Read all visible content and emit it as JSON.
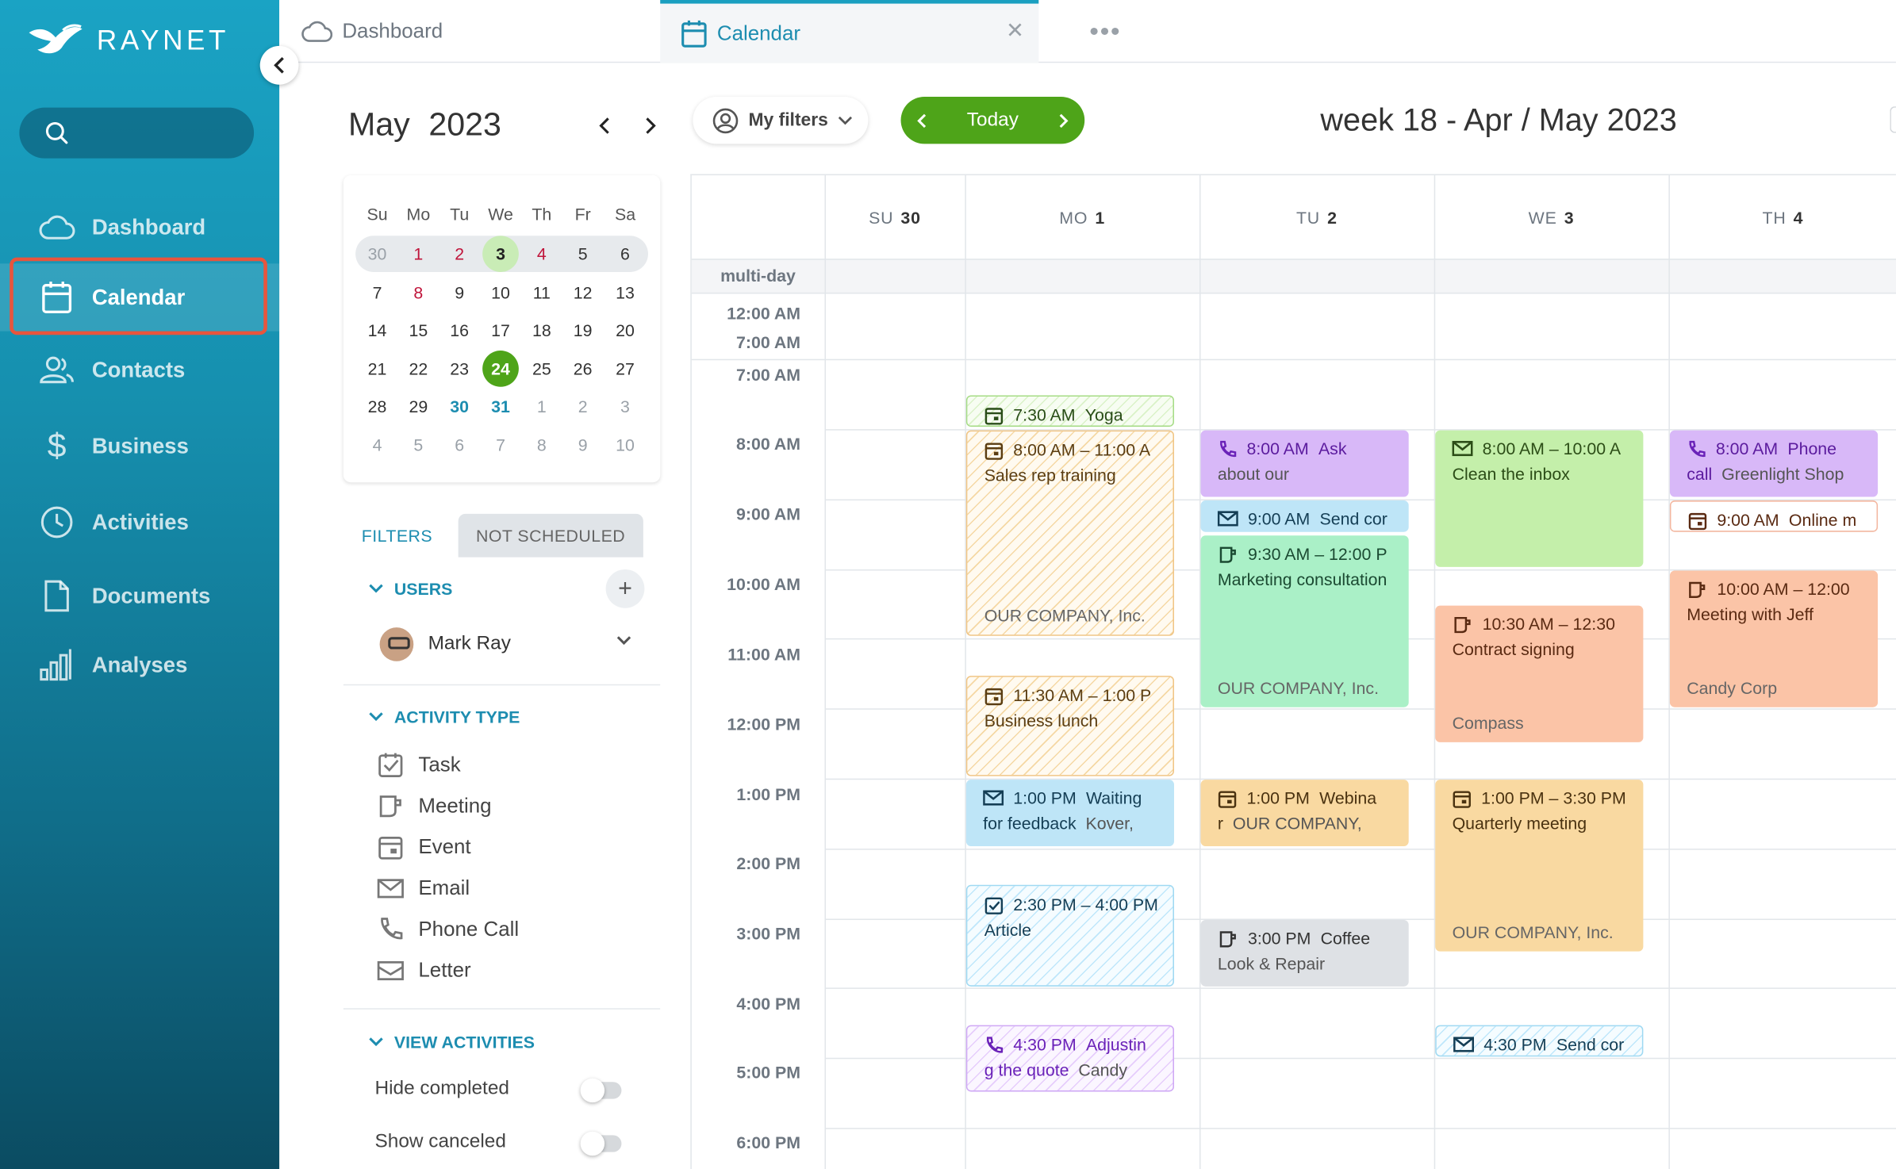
{
  "app": {
    "brand": "RAYNET",
    "colors": {
      "sidebar": "#168fae",
      "accent": "#1d8db0",
      "today": "#4ea419",
      "highlight": "#e8553d"
    }
  },
  "sidebar": {
    "search_placeholder": "",
    "items": [
      {
        "label": "Dashboard",
        "icon": "cloud-icon"
      },
      {
        "label": "Calendar",
        "icon": "calendar-icon",
        "active": true
      },
      {
        "label": "Contacts",
        "icon": "contacts-icon"
      },
      {
        "label": "Business",
        "icon": "dollar-icon"
      },
      {
        "label": "Activities",
        "icon": "clock-icon"
      },
      {
        "label": "Documents",
        "icon": "document-icon"
      },
      {
        "label": "Analyses",
        "icon": "bar-chart-icon"
      }
    ]
  },
  "tabs": [
    {
      "label": "Dashboard",
      "icon": "cloud-icon"
    },
    {
      "label": "Calendar",
      "icon": "calendar-icon",
      "active": true
    }
  ],
  "tabs_more": "•••",
  "mini_calendar": {
    "month": "May",
    "year": "2023",
    "weekdays": [
      "Su",
      "Mo",
      "Tu",
      "We",
      "Th",
      "Fr",
      "Sa"
    ],
    "weeks": [
      [
        "30",
        "1",
        "2",
        "3",
        "4",
        "5",
        "6"
      ],
      [
        "7",
        "8",
        "9",
        "10",
        "11",
        "12",
        "13"
      ],
      [
        "14",
        "15",
        "16",
        "17",
        "18",
        "19",
        "20"
      ],
      [
        "21",
        "22",
        "23",
        "24",
        "25",
        "26",
        "27"
      ],
      [
        "28",
        "29",
        "30",
        "31",
        "1",
        "2",
        "3"
      ],
      [
        "4",
        "5",
        "6",
        "7",
        "8",
        "9",
        "10"
      ]
    ],
    "today": "24",
    "holidays": [
      "1",
      "2",
      "4",
      "8"
    ]
  },
  "filters": {
    "tab_filters": "FILTERS",
    "tab_not_scheduled": "NOT SCHEDULED",
    "users_title": "USERS",
    "add": "+",
    "user_name": "Mark Ray",
    "activity_type_title": "ACTIVITY TYPE",
    "activity_types": [
      {
        "label": "Task",
        "icon": "task-icon"
      },
      {
        "label": "Meeting",
        "icon": "meeting-icon"
      },
      {
        "label": "Event",
        "icon": "event-icon"
      },
      {
        "label": "Email",
        "icon": "email-icon"
      },
      {
        "label": "Phone Call",
        "icon": "phone-icon"
      },
      {
        "label": "Letter",
        "icon": "letter-icon"
      }
    ],
    "view_activities_title": "VIEW ACTIVITIES",
    "toggles": [
      {
        "label": "Hide completed",
        "on": false
      },
      {
        "label": "Show canceled",
        "on": false
      }
    ]
  },
  "toolbar": {
    "my_filters": "My filters",
    "today": "Today",
    "week_title": "week 18 - Apr / May 2023"
  },
  "calendar": {
    "days": [
      {
        "dow": "SU",
        "num": "30"
      },
      {
        "dow": "MO",
        "num": "1"
      },
      {
        "dow": "TU",
        "num": "2"
      },
      {
        "dow": "WE",
        "num": "3"
      },
      {
        "dow": "TH",
        "num": "4"
      }
    ],
    "multiday_label": "multi-day",
    "time_labels": [
      "12:00 AM",
      "7:00 AM",
      "7:00 AM",
      "8:00 AM",
      "9:00 AM",
      "10:00 AM",
      "11:00 AM",
      "12:00 PM",
      "1:00 PM",
      "2:00 PM",
      "3:00 PM",
      "4:00 PM",
      "5:00 PM",
      "6:00 PM"
    ],
    "events": [
      {
        "type": "event",
        "time": "7:30 AM",
        "title": "Yoga",
        "sub": ""
      },
      {
        "type": "event",
        "time": "8:00 AM – 11:00 A",
        "title": "Sales rep training",
        "sub": "OUR COMPANY, Inc."
      },
      {
        "type": "event",
        "time": "11:30 AM – 1:00 P",
        "title": "Business lunch",
        "sub": ""
      },
      {
        "type": "email",
        "time": "1:00 PM",
        "title": "Waiting",
        "title2": "for feedback",
        "company": "Kover,",
        "sub": ""
      },
      {
        "type": "task",
        "time": "2:30 PM – 4:00 PM",
        "title": "Article",
        "sub": ""
      },
      {
        "type": "phone",
        "time": "4:30 PM",
        "title": "Adjustin",
        "title2": "g the quote",
        "company": "Candy",
        "sub": ""
      },
      {
        "type": "phone",
        "time": "8:00 AM",
        "title": "Ask",
        "title2": "about our",
        "sub": ""
      },
      {
        "type": "email",
        "time": "9:00 AM",
        "title": "Send cor",
        "sub": ""
      },
      {
        "type": "meeting",
        "time": "9:30 AM – 12:00 P",
        "title": "Marketing consultation",
        "sub": "OUR COMPANY, Inc."
      },
      {
        "type": "event",
        "time": "1:00 PM",
        "title": "Webina",
        "title2": "r",
        "company": "OUR COMPANY,",
        "sub": ""
      },
      {
        "type": "meeting",
        "time": "3:00 PM",
        "title": "Coffee",
        "title2": "Look & Repair",
        "sub": ""
      },
      {
        "type": "email",
        "time": "8:00 AM – 10:00 A",
        "title": "Clean the inbox",
        "sub": ""
      },
      {
        "type": "meeting",
        "time": "10:30 AM – 12:30",
        "title": "Contract signing",
        "sub": "Compass"
      },
      {
        "type": "event",
        "time": "1:00 PM – 3:30 PM",
        "title": "Quarterly meeting",
        "sub": "OUR COMPANY, Inc."
      },
      {
        "type": "email",
        "time": "4:30 PM",
        "title": "Send cor",
        "sub": ""
      },
      {
        "type": "phone",
        "time": "8:00 AM",
        "title": "Phone",
        "title2": "call",
        "company": "Greenlight Shop",
        "sub": ""
      },
      {
        "type": "event",
        "time": "9:00 AM",
        "title": "Online m",
        "sub": ""
      },
      {
        "type": "meeting",
        "time": "10:00 AM – 12:00",
        "title": "Meeting with Jeff",
        "sub": "Candy Corp"
      }
    ]
  }
}
